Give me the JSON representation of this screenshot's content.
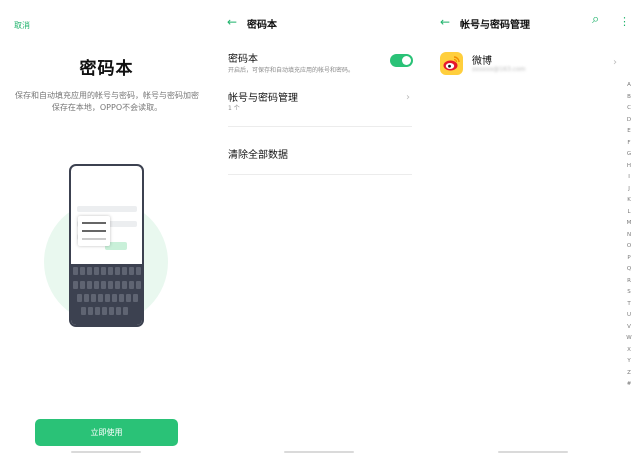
{
  "panel1": {
    "cancel_label": "取消",
    "title": "密码本",
    "description": "保存和自动填充应用的帐号与密码，帐号与密码加密保存在本地，OPPO不会读取。",
    "illustration": {
      "item1": "XXXXXX7890",
      "item2": "XXXXXX7890"
    },
    "primary_button": "立即使用"
  },
  "panel2": {
    "back_icon": "←",
    "title": "密码本",
    "toggle_row": {
      "title": "密码本",
      "subtitle": "开启后，可保存和自动填充应用的帐号和密码。",
      "enabled": true
    },
    "accounts_row": {
      "title": "帐号与密码管理",
      "count": "1 个",
      "chevron": "›"
    },
    "clear_row": {
      "title": "清除全部数据"
    }
  },
  "panel3": {
    "back_icon": "←",
    "title": "帐号与密码管理",
    "search_icon": "⌕",
    "more_icon": "⋮",
    "account": {
      "name": "微博",
      "username": "xxxxxx@163.com",
      "chevron": "›"
    },
    "alphabet": [
      "A",
      "B",
      "C",
      "D",
      "E",
      "F",
      "G",
      "H",
      "I",
      "J",
      "K",
      "L",
      "M",
      "N",
      "O",
      "P",
      "Q",
      "R",
      "S",
      "T",
      "U",
      "V",
      "W",
      "X",
      "Y",
      "Z",
      "#"
    ]
  },
  "colors": {
    "accent": "#2ac277",
    "text_green": "#1eb36b",
    "dark": "#3c4150"
  }
}
